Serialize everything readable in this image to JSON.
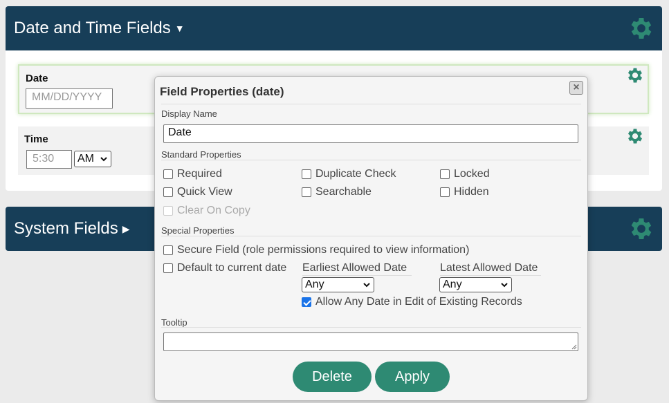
{
  "date_time_section": {
    "title": "Date and Time Fields",
    "caret": "▼",
    "fields": [
      {
        "label": "Date",
        "placeholder": "MM/DD/YYYY"
      },
      {
        "label": "Time",
        "time_placeholder": "5:30",
        "ampm": "AM"
      }
    ]
  },
  "system_section": {
    "title": "System Fields",
    "caret": "▶"
  },
  "dialog": {
    "title": "Field Properties (date)",
    "close": "×",
    "display_name_label": "Display Name",
    "display_name_value": "Date",
    "standard_label": "Standard Properties",
    "standard": {
      "required": "Required",
      "duplicate_check": "Duplicate Check",
      "locked": "Locked",
      "quick_view": "Quick View",
      "searchable": "Searchable",
      "hidden": "Hidden",
      "clear_on_copy": "Clear On Copy"
    },
    "special_label": "Special Properties",
    "special": {
      "secure_field": "Secure Field (role permissions required to view information)",
      "default_current": "Default to current date",
      "earliest_label": "Earliest Allowed Date",
      "earliest_value": "Any",
      "latest_label": "Latest Allowed Date",
      "latest_value": "Any",
      "allow_any_date": "Allow Any Date in Edit of Existing Records"
    },
    "tooltip_label": "Tooltip",
    "delete_label": "Delete",
    "apply_label": "Apply"
  },
  "colors": {
    "header_bg": "#173e58",
    "accent": "#2e8a73",
    "checkbox_checked": "#1a73e8"
  }
}
